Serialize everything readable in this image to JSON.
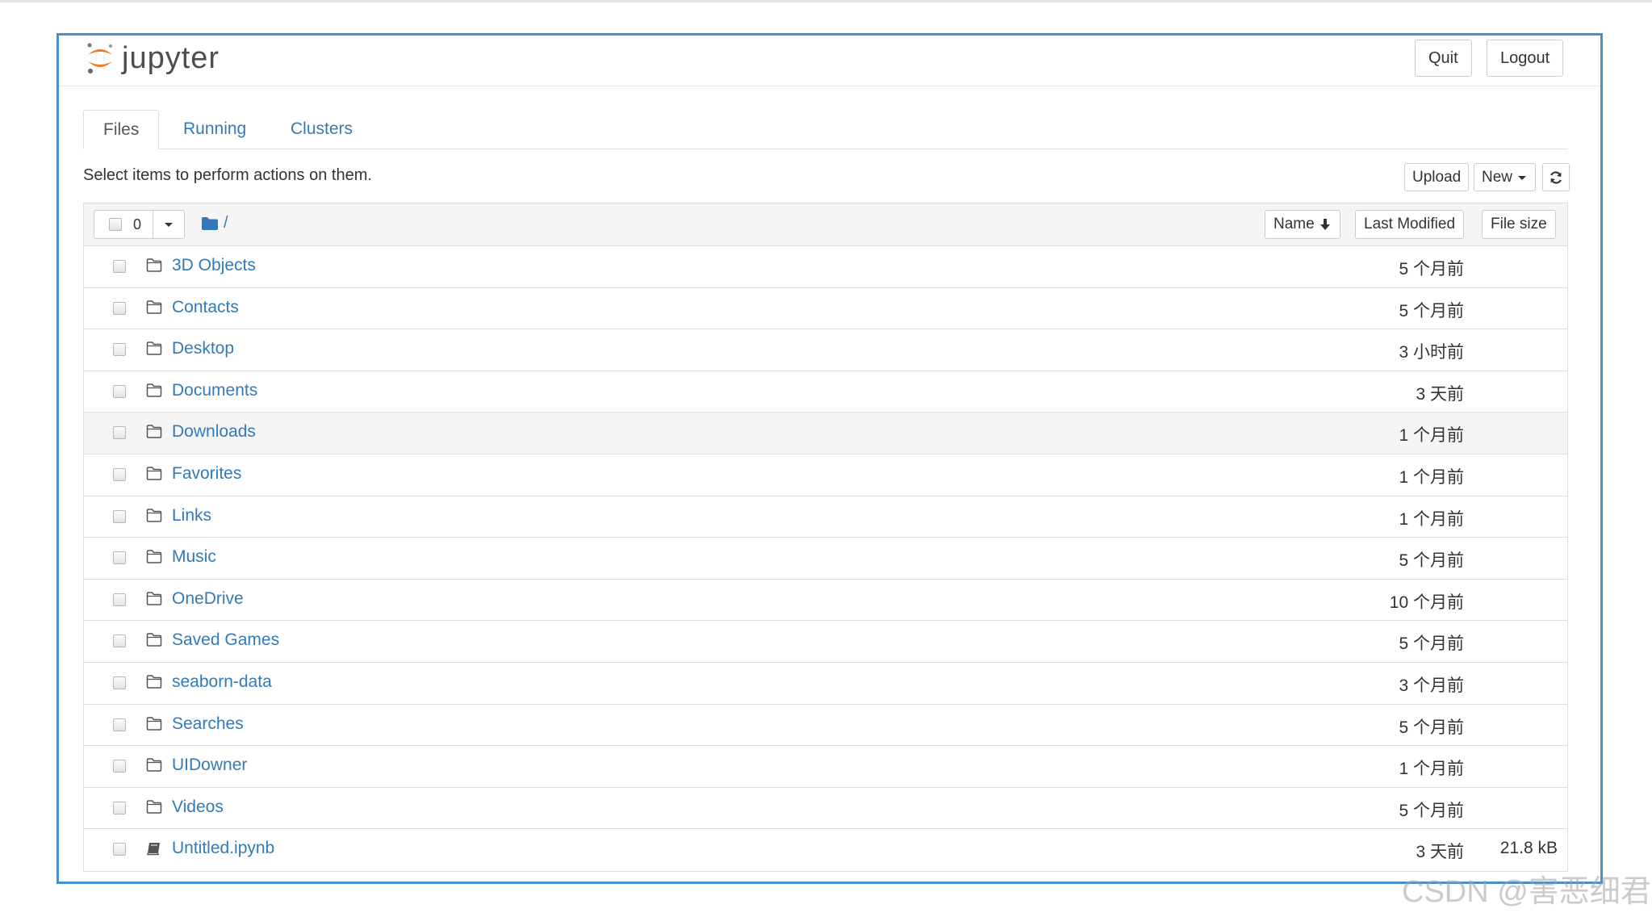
{
  "app": {
    "logo_text": "jupyter",
    "quit_label": "Quit",
    "logout_label": "Logout"
  },
  "tabs": [
    {
      "label": "Files",
      "active": true
    },
    {
      "label": "Running",
      "active": false
    },
    {
      "label": "Clusters",
      "active": false
    }
  ],
  "toolbar": {
    "instructions": "Select items to perform actions on them.",
    "upload_label": "Upload",
    "new_label": "New",
    "refresh_icon": "refresh-icon"
  },
  "list_header": {
    "selected_count": "0",
    "path": "/",
    "sort_name_label": "Name",
    "sort_modified_label": "Last Modified",
    "sort_size_label": "File size"
  },
  "items": [
    {
      "name": "3D Objects",
      "type": "folder",
      "modified": "5 个月前",
      "size": ""
    },
    {
      "name": "Contacts",
      "type": "folder",
      "modified": "5 个月前",
      "size": ""
    },
    {
      "name": "Desktop",
      "type": "folder",
      "modified": "3 小时前",
      "size": ""
    },
    {
      "name": "Documents",
      "type": "folder",
      "modified": "3 天前",
      "size": ""
    },
    {
      "name": "Downloads",
      "type": "folder",
      "modified": "1 个月前",
      "size": ""
    },
    {
      "name": "Favorites",
      "type": "folder",
      "modified": "1 个月前",
      "size": ""
    },
    {
      "name": "Links",
      "type": "folder",
      "modified": "1 个月前",
      "size": ""
    },
    {
      "name": "Music",
      "type": "folder",
      "modified": "5 个月前",
      "size": ""
    },
    {
      "name": "OneDrive",
      "type": "folder",
      "modified": "10 个月前",
      "size": ""
    },
    {
      "name": "Saved Games",
      "type": "folder",
      "modified": "5 个月前",
      "size": ""
    },
    {
      "name": "seaborn-data",
      "type": "folder",
      "modified": "3 个月前",
      "size": ""
    },
    {
      "name": "Searches",
      "type": "folder",
      "modified": "5 个月前",
      "size": ""
    },
    {
      "name": "UIDowner",
      "type": "folder",
      "modified": "1 个月前",
      "size": ""
    },
    {
      "name": "Videos",
      "type": "folder",
      "modified": "5 个月前",
      "size": ""
    },
    {
      "name": "Untitled.ipynb",
      "type": "notebook",
      "modified": "3 天前",
      "size": "21.8 kB"
    }
  ],
  "watermark": "CSDN @害恶细君",
  "colors": {
    "link": "#337ab7",
    "frame_border": "#4a90c8",
    "logo_orange": "#f37726",
    "header_bg": "#f5f5f5"
  }
}
